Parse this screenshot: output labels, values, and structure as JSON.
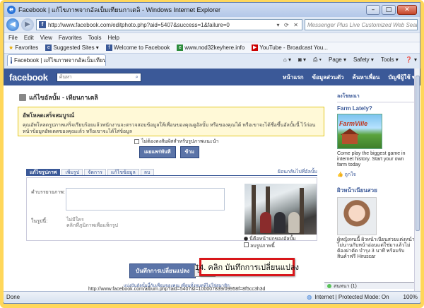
{
  "window": {
    "title": "Facebook | แก้ไขภาพจากอัลเบ็มเทียนกาเตลิ - Windows Internet Explorer",
    "minimize": "–",
    "maximize": "□",
    "close": "✕"
  },
  "address": {
    "url": "http://www.facebook.com/editphoto.php?aid=5407&success=1&failure=0",
    "controls": "▾ ⟳ ✕"
  },
  "search": {
    "placeholder": "Messenger Plus Live Customized Web Search",
    "icon": "search-icon"
  },
  "menu": [
    "File",
    "Edit",
    "View",
    "Favorites",
    "Tools",
    "Help"
  ],
  "favorites": {
    "label": "Favorites",
    "items": [
      "Suggested Sites ▾",
      "Welcome to Facebook",
      "www.nod32keyhere.info",
      "YouTube - Broadcast You..."
    ]
  },
  "tab": {
    "title": "Facebook | แก้ไขภาพจากอัลเบ็มเทียนกาเตลิ"
  },
  "toolbar": [
    "Page ▾",
    "Safety ▾",
    "Tools ▾",
    "❓ ▾"
  ],
  "fb": {
    "logo": "facebook",
    "search_placeholder": "ค้นหา",
    "nav": [
      "หน้าแรก",
      "ข้อมูลส่วนตัว",
      "ค้นหาเพื่อน",
      "บัญชีผู้ใช้ ▾"
    ]
  },
  "breadcrumb": "แก้ไขอัลบั้ม - เทียนกาเตลิ",
  "notice": {
    "title": "อัพโหลดเสร็จสมบูรณ์",
    "body": "คุณอัพโหลดรูปภาพเสร็จเรียบร้อยแล้วพนักงานจะตรวจสอบข้อมูลให้เพื่อนของคุณดูอัลบั้ม หรือของคุณได้ หรือเขาจะได้ชื่อขึ้นอัลบั้มนี้ ไว้ก่อนหน้าข้อมูลอัพเดตของคุณแล้ว หรือเขาจะได้ใส่ข้อมูล"
  },
  "skip_text": "ไม่ต้องลงสัมผัสสำหรับรูปภาพแนะนำ",
  "buttons": {
    "publish": "เผยแพร่ทันที",
    "skip": "ข้าม"
  },
  "edit_tabs": [
    "แก้ไขรูปภาพ",
    "เพิ่มรูป",
    "จัดการ",
    "แก้ไขข้อมูล",
    "ลบ"
  ],
  "edit_tabs_right": "ย้อนกลับไปที่อัลบั้ม",
  "caption_label": "คำบรรยายภาพ:",
  "tag_label": "ในรูปนี้:",
  "tag_text": [
    "ไม่มีใคร",
    "คลิกที่ภูมิภาพเพื่อแท็กรูป"
  ],
  "radios": [
    {
      "label": "นี่คือหน้าปกของอัลบั้ม",
      "checked": true
    },
    {
      "label": "ลบรูปภาพนี้",
      "checked": false
    }
  ],
  "save_button": "บันทึกการเปลี่ยนแปลง",
  "cancel_button": "ยกเลิก",
  "footer_note": "แบ่งปันอัลบั้มนี้กับเพื่อนของคุณ เพื่อนทั้งหมดที่ไม่ใช่สมาชิก:",
  "footer_link": "http://www.facebook.com/album.php?aid=5407&l=100007839/09958f=8f5cc3h3d",
  "sidebar": {
    "header": "ลงโฆษณา",
    "ad1_title": "Farm Lately?",
    "ad1_image_text": "FarmVille",
    "ad1_body": "Come play the biggest game in internet history. Start your own farm today",
    "ad1_like": "ถูกใจ",
    "ad2_title": "ผิวหน้าเนียนสวย",
    "ad2_body": "ผู้หญิงหนนี้ ผิวหน้าเนียนสวยแต่งหน้าไม่นานกับหน้าอ่อนแด่ใช่มาแล้วไม่ต้องผ่าตัด บำรุง 3 นาที พร้อมรับสินค้าฟรี Hiruscar"
  },
  "chat": "สนทนา (1)",
  "status": {
    "left": "Done",
    "zone": "Internet | Protected Mode: On",
    "zoom": "100%"
  },
  "callout": "14. คลิก บันทึกการเปลี่ยนแปลง"
}
